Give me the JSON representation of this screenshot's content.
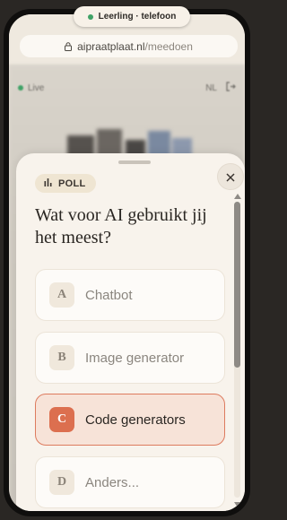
{
  "status_pill": {
    "label": "Leerling · telefoon",
    "dot_color": "#3fa266"
  },
  "browser": {
    "domain": "aipraatplaat.nl",
    "path": "/meedoen"
  },
  "background": {
    "live_label": "Live",
    "language": "NL"
  },
  "sheet": {
    "badge_label": "POLL",
    "question": "Wat voor AI gebruikt jij het meest?",
    "options": [
      {
        "letter": "A",
        "label": "Chatbot",
        "selected": false
      },
      {
        "letter": "B",
        "label": "Image generator",
        "selected": false
      },
      {
        "letter": "C",
        "label": "Code generators",
        "selected": true
      },
      {
        "letter": "D",
        "label": "Anders...",
        "selected": false
      }
    ]
  },
  "colors": {
    "accent": "#dc6f4f",
    "accent_bg": "#f7e3d8",
    "sheet_bg": "#f8f3ec"
  }
}
